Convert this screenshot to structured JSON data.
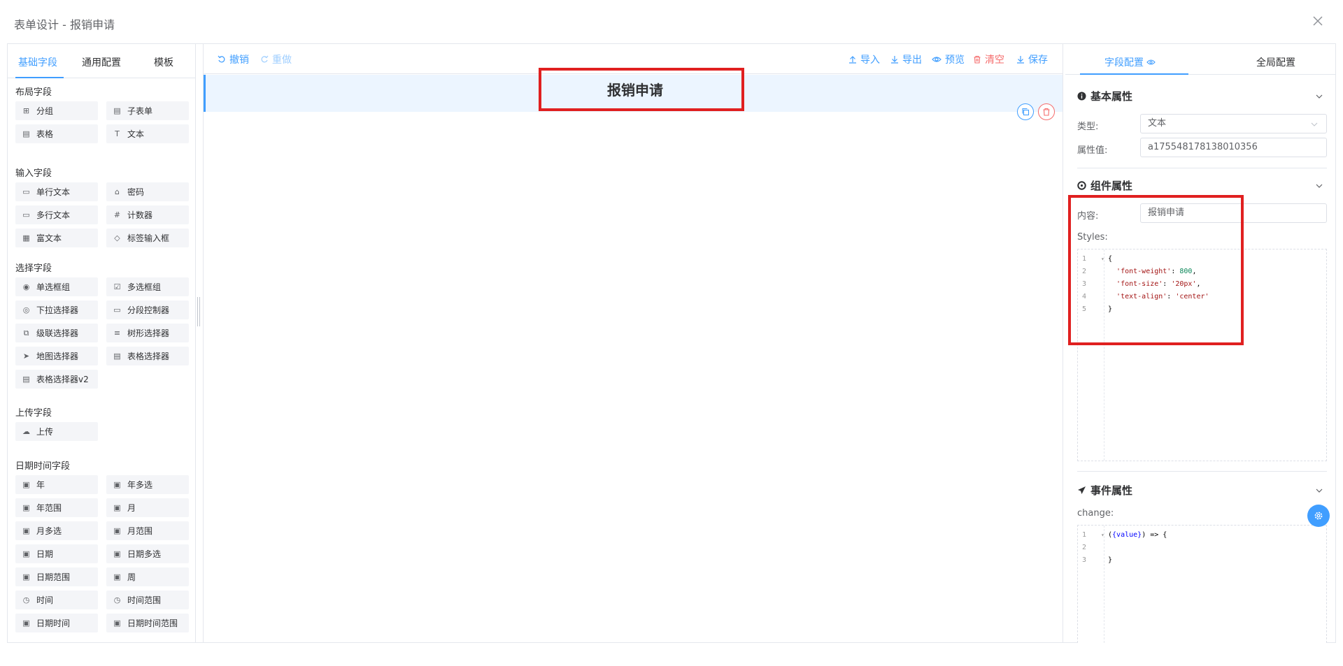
{
  "dialog": {
    "title": "表单设计 - 报销申请"
  },
  "left_panel": {
    "tabs": [
      "基础字段",
      "通用配置",
      "模板"
    ],
    "groups": [
      {
        "title": "布局字段",
        "items": [
          "分组",
          "子表单",
          "表格",
          "文本"
        ]
      },
      {
        "title": "输入字段",
        "items": [
          "单行文本",
          "密码",
          "多行文本",
          "计数器",
          "富文本",
          "标签输入框"
        ]
      },
      {
        "title": "选择字段",
        "items": [
          "单选框组",
          "多选框组",
          "下拉选择器",
          "分段控制器",
          "级联选择器",
          "树形选择器",
          "地图选择器",
          "表格选择器",
          "表格选择器v2"
        ]
      },
      {
        "title": "上传字段",
        "items": [
          "上传"
        ]
      },
      {
        "title": "日期时间字段",
        "items": [
          "年",
          "年多选",
          "年范围",
          "月",
          "月多选",
          "月范围",
          "日期",
          "日期多选",
          "日期范围",
          "周",
          "时间",
          "时间范围",
          "日期时间",
          "日期时间范围"
        ]
      }
    ]
  },
  "toolbar": {
    "undo": "撤销",
    "redo": "重做",
    "import": "导入",
    "export": "导出",
    "preview": "预览",
    "clear": "清空",
    "save": "保存"
  },
  "canvas": {
    "title": "报销申请"
  },
  "right_panel": {
    "tabs": [
      "字段配置",
      "全局配置"
    ],
    "basic": {
      "title": "基本属性",
      "type_label": "类型:",
      "type_value": "文本",
      "value_label": "属性值:",
      "value_value": "a175548178138010356"
    },
    "component": {
      "title": "组件属性",
      "content_label": "内容:",
      "content_value": "报销申请",
      "styles_label": "Styles:",
      "styles_lines": [
        "{",
        "  'font-weight': 800,",
        "  'font-size': '20px',",
        "  'text-align': 'center'",
        "}"
      ]
    },
    "event": {
      "title": "事件属性",
      "change_label": "change:",
      "code_lines": [
        "({value}) => {",
        "",
        "}"
      ]
    }
  },
  "colors": {
    "primary": "#409eff",
    "danger": "#f56c6c",
    "highlight": "#e02020"
  }
}
